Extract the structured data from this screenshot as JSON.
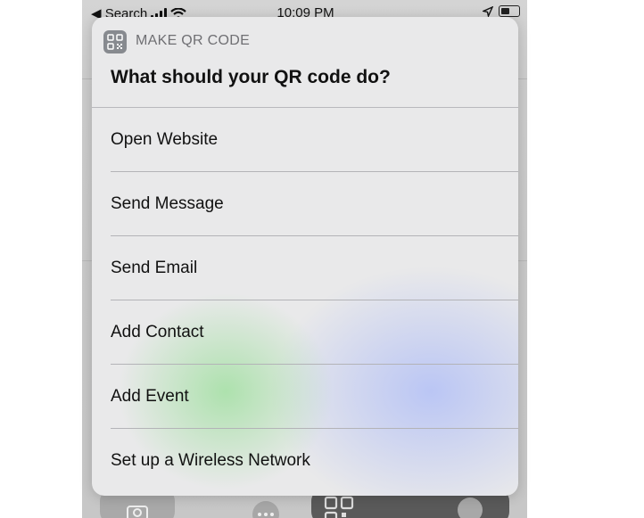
{
  "status_bar": {
    "back_label": "◀ Search",
    "time": "10:09 PM"
  },
  "sheet": {
    "app_name": "MAKE QR CODE",
    "question": "What should your QR code do?",
    "options": [
      {
        "label": "Open Website"
      },
      {
        "label": "Send Message"
      },
      {
        "label": "Send Email"
      },
      {
        "label": "Add Contact"
      },
      {
        "label": "Add Event"
      },
      {
        "label": "Set up a Wireless Network"
      }
    ]
  },
  "colors": {
    "green_glow": "#aae1aa",
    "blue_glow": "#b8c4f5",
    "sheet_bg": "#e9e9ea",
    "active_tab": "#5a5a5a"
  },
  "toolbar": {
    "icons": [
      "camera-icon",
      "more-icon",
      "qr-code-icon",
      "message-icon"
    ]
  }
}
